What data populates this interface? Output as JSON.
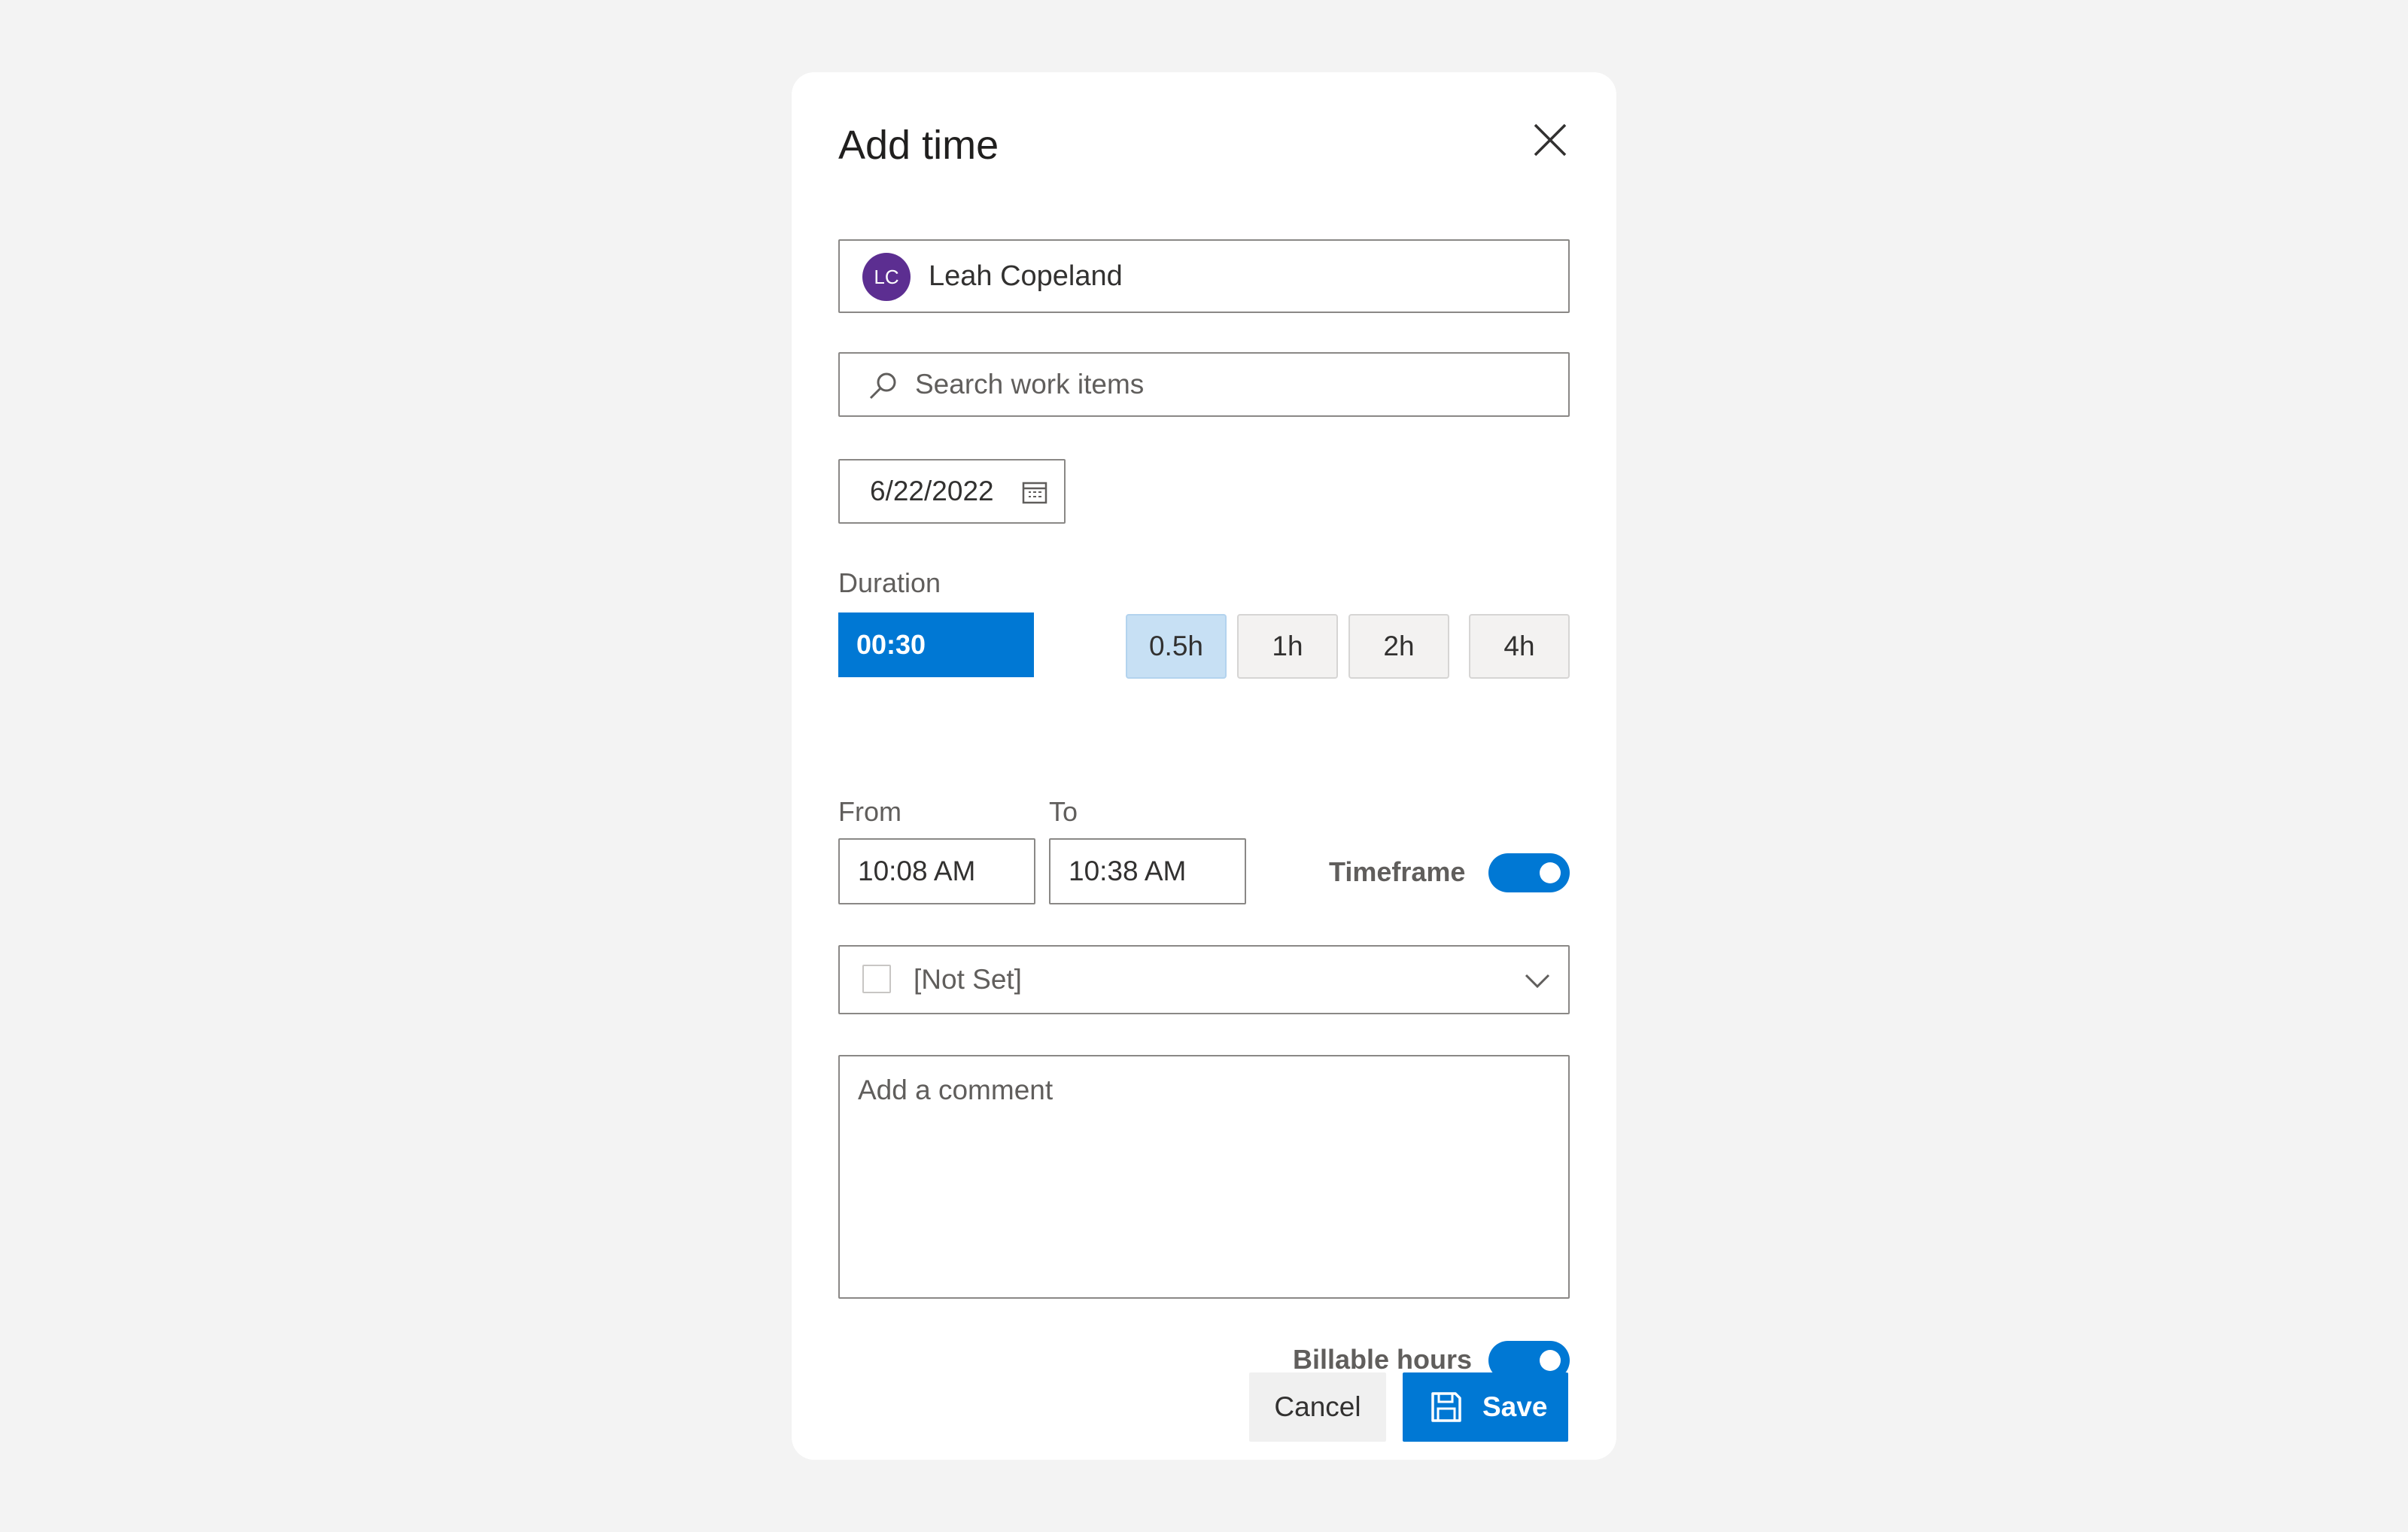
{
  "dialog": {
    "title": "Add time",
    "close_icon": "close-icon"
  },
  "user": {
    "initials": "LC",
    "name": "Leah Copeland",
    "avatar_color": "#5c2e91"
  },
  "search": {
    "placeholder": "Search work items",
    "icon": "search-icon"
  },
  "date": {
    "value": "6/22/2022",
    "icon": "calendar-icon"
  },
  "duration": {
    "label": "Duration",
    "value": "00:30",
    "presets": [
      {
        "label": "0.5h",
        "active": true
      },
      {
        "label": "1h",
        "active": false
      },
      {
        "label": "2h",
        "active": false
      },
      {
        "label": "4h",
        "active": false
      }
    ]
  },
  "time": {
    "from_label": "From",
    "from_value": "10:08 AM",
    "to_label": "To",
    "to_value": "10:38 AM",
    "timeframe_label": "Timeframe",
    "timeframe_on": true
  },
  "category": {
    "value": "[Not Set]",
    "icon": "chevron-down-icon"
  },
  "comment": {
    "placeholder": "Add a comment"
  },
  "billable": {
    "label": "Billable hours",
    "on": true
  },
  "actions": {
    "cancel_label": "Cancel",
    "save_label": "Save",
    "save_icon": "save-icon"
  },
  "colors": {
    "accent": "#0078d4",
    "preset_active": "#c7e0f4",
    "background": "#f3f3f3"
  }
}
